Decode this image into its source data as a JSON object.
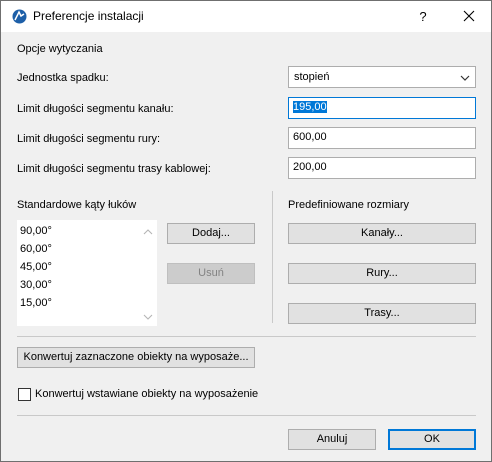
{
  "window": {
    "title": "Preferencje instalacji",
    "help_label": "?",
    "icons": {
      "app": "archicad-app-icon",
      "close": "close-icon"
    }
  },
  "section_title": "Opcje wytyczania",
  "slope_unit": {
    "label": "Jednostka spadku:",
    "value": "stopień"
  },
  "duct_limit": {
    "label": "Limit długości segmentu kanału:",
    "value": "195,00"
  },
  "pipe_limit": {
    "label": "Limit długości segmentu rury:",
    "value": "600,00"
  },
  "cable_limit": {
    "label": "Limit długości segmentu trasy kablowej:",
    "value": "200,00"
  },
  "arc_angles": {
    "title": "Standardowe kąty łuków",
    "items": [
      "90,00°",
      "60,00°",
      "45,00°",
      "30,00°",
      "15,00°"
    ],
    "add_label": "Dodaj...",
    "remove_label": "Usuń"
  },
  "predefined": {
    "title": "Predefiniowane rozmiary",
    "ducts_label": "Kanały...",
    "pipes_label": "Rury...",
    "routes_label": "Trasy..."
  },
  "convert_selected_label": "Konwertuj zaznaczone obiekty na wyposaże...",
  "convert_placed": {
    "label": "Konwertuj wstawiane obiekty na wyposażenie",
    "checked": false
  },
  "footer": {
    "cancel_label": "Anuluj",
    "ok_label": "OK"
  },
  "colors": {
    "accent": "#0078d7",
    "dialog_bg": "#f0f0f0",
    "button_bg": "#e1e1e1"
  }
}
